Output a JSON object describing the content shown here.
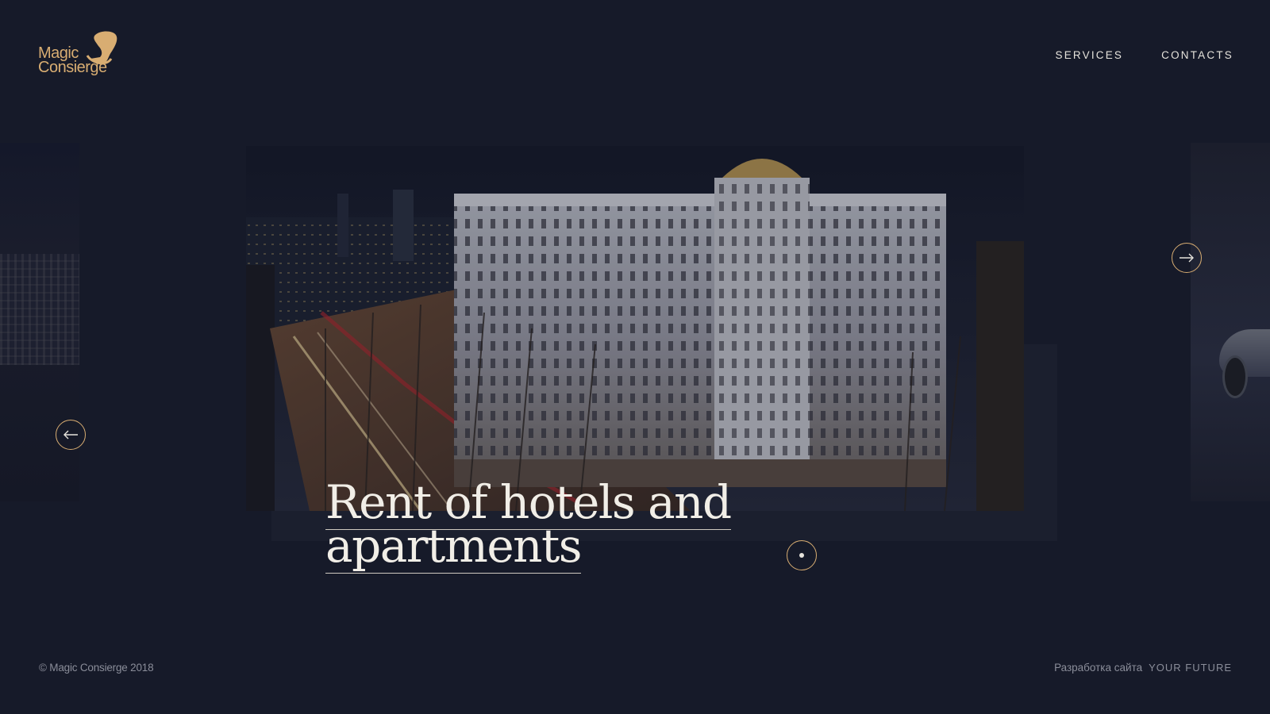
{
  "brand": {
    "logo_line1": "Magic",
    "logo_line2": "Consierge",
    "logo_icon": "top-hat-icon",
    "accent_color": "#d8ad72"
  },
  "nav": {
    "items": [
      {
        "label": "SERVICES"
      },
      {
        "label": "CONTACTS"
      }
    ]
  },
  "slider": {
    "title_line1": "Rent of hotels and",
    "title_line2": "apartments",
    "prev_icon": "arrow-left-icon",
    "next_icon": "arrow-right-icon",
    "pagination_icon": "dot-icon"
  },
  "footer": {
    "copyright": "© Magic Consierge  2018",
    "dev_label": "Разработка сайта",
    "dev_brand": "YOUR FUTURE"
  }
}
